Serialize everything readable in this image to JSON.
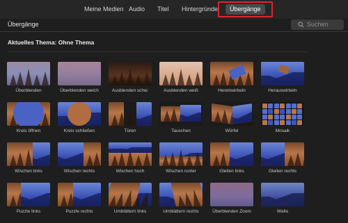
{
  "tabs": [
    {
      "label": "Meine Medien"
    },
    {
      "label": "Audio"
    },
    {
      "label": "Titel"
    },
    {
      "label": "Hintergründe"
    },
    {
      "label": "Übergänge",
      "active": true
    }
  ],
  "header": {
    "title": "Übergänge",
    "search_placeholder": "Suchen"
  },
  "theme": {
    "label": "Aktuelles Thema: Ohne Thema"
  },
  "transitions": [
    {
      "label": "Überblenden",
      "style": "faded"
    },
    {
      "label": "Überblenden weich",
      "style": "pinkblur"
    },
    {
      "label": "Ausblenden schw.",
      "style": "dark"
    },
    {
      "label": "Ausblenden weiß",
      "style": "light"
    },
    {
      "label": "Hereinwirbeln",
      "style": "swirl-in"
    },
    {
      "label": "Herauswirbeln",
      "style": "swirl-out"
    },
    {
      "label": "Kreis öffnen",
      "style": "circle-open"
    },
    {
      "label": "Kreis schließen",
      "style": "circle-close"
    },
    {
      "label": "Türen",
      "style": "doors"
    },
    {
      "label": "Tauschen",
      "style": "swap"
    },
    {
      "label": "Würfel",
      "style": "cube"
    },
    {
      "label": "Mosaik",
      "style": "mosaic"
    },
    {
      "label": "Wischen links",
      "style": "wipe"
    },
    {
      "label": "Wischen rechts",
      "style": "wipe"
    },
    {
      "label": "Wischen hoch",
      "style": "wipe-up"
    },
    {
      "label": "Wischen runter",
      "style": "wipe-down"
    },
    {
      "label": "Gleiten links",
      "style": "slide"
    },
    {
      "label": "Gleiten rechts",
      "style": "slide"
    },
    {
      "label": "Puzzle links",
      "style": "puzzle"
    },
    {
      "label": "Puzzle rechts",
      "style": "puzzle"
    },
    {
      "label": "Umblättern links",
      "style": "page"
    },
    {
      "label": "Umblättern rechts",
      "style": "page"
    },
    {
      "label": "Überblenden Zoom",
      "style": "zoom"
    },
    {
      "label": "Welle",
      "style": "wave"
    }
  ],
  "colors": {
    "highlight_border": "#e0262b",
    "background": "#1e1e1e",
    "forest": "#b8774a",
    "mountain_blue": "#3f56b8"
  }
}
